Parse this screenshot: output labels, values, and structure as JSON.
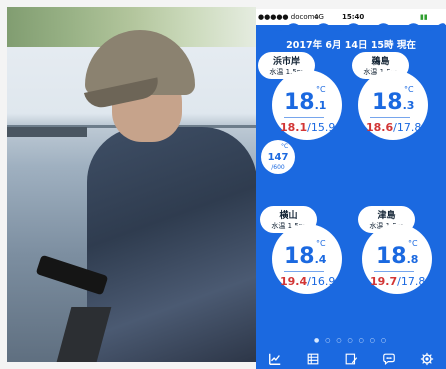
{
  "status_bar": {
    "carrier": "●●●●● docomo",
    "network": "4G",
    "time": "15:40",
    "battery": "100%"
  },
  "date_line": "2017年 6月 14日 15時 現在",
  "stations": [
    {
      "name": "浜市岸",
      "water_temp_label": "水温",
      "depth": "1.5m",
      "temp": "18",
      "decimal": ".1",
      "unit": "°C",
      "high": "18.1",
      "low": "15.9"
    },
    {
      "name": "鵜島",
      "water_temp_label": "水温",
      "depth": "1.5m",
      "temp": "18",
      "decimal": ".3",
      "unit": "°C",
      "high": "18.6",
      "low": "17.8"
    },
    {
      "name": "横山",
      "water_temp_label": "水温",
      "depth": "1.5m",
      "temp": "18",
      "decimal": ".4",
      "unit": "°C",
      "high": "19.4",
      "low": "16.9"
    },
    {
      "name": "津島",
      "water_temp_label": "水温",
      "depth": "1.5m",
      "temp": "18",
      "decimal": ".8",
      "unit": "°C",
      "high": "19.7",
      "low": "17.8"
    }
  ],
  "mini": {
    "value": "147",
    "sub": "/600",
    "unit": "°C"
  },
  "pagination": "● ○ ○ ○ ○ ○ ○",
  "tabs": [
    {
      "icon": "chart-icon"
    },
    {
      "icon": "list-icon"
    },
    {
      "icon": "edit-icon"
    },
    {
      "icon": "chat-icon"
    },
    {
      "icon": "settings-icon"
    }
  ],
  "colors": {
    "primary": "#1b69e0",
    "high": "#d23535"
  }
}
